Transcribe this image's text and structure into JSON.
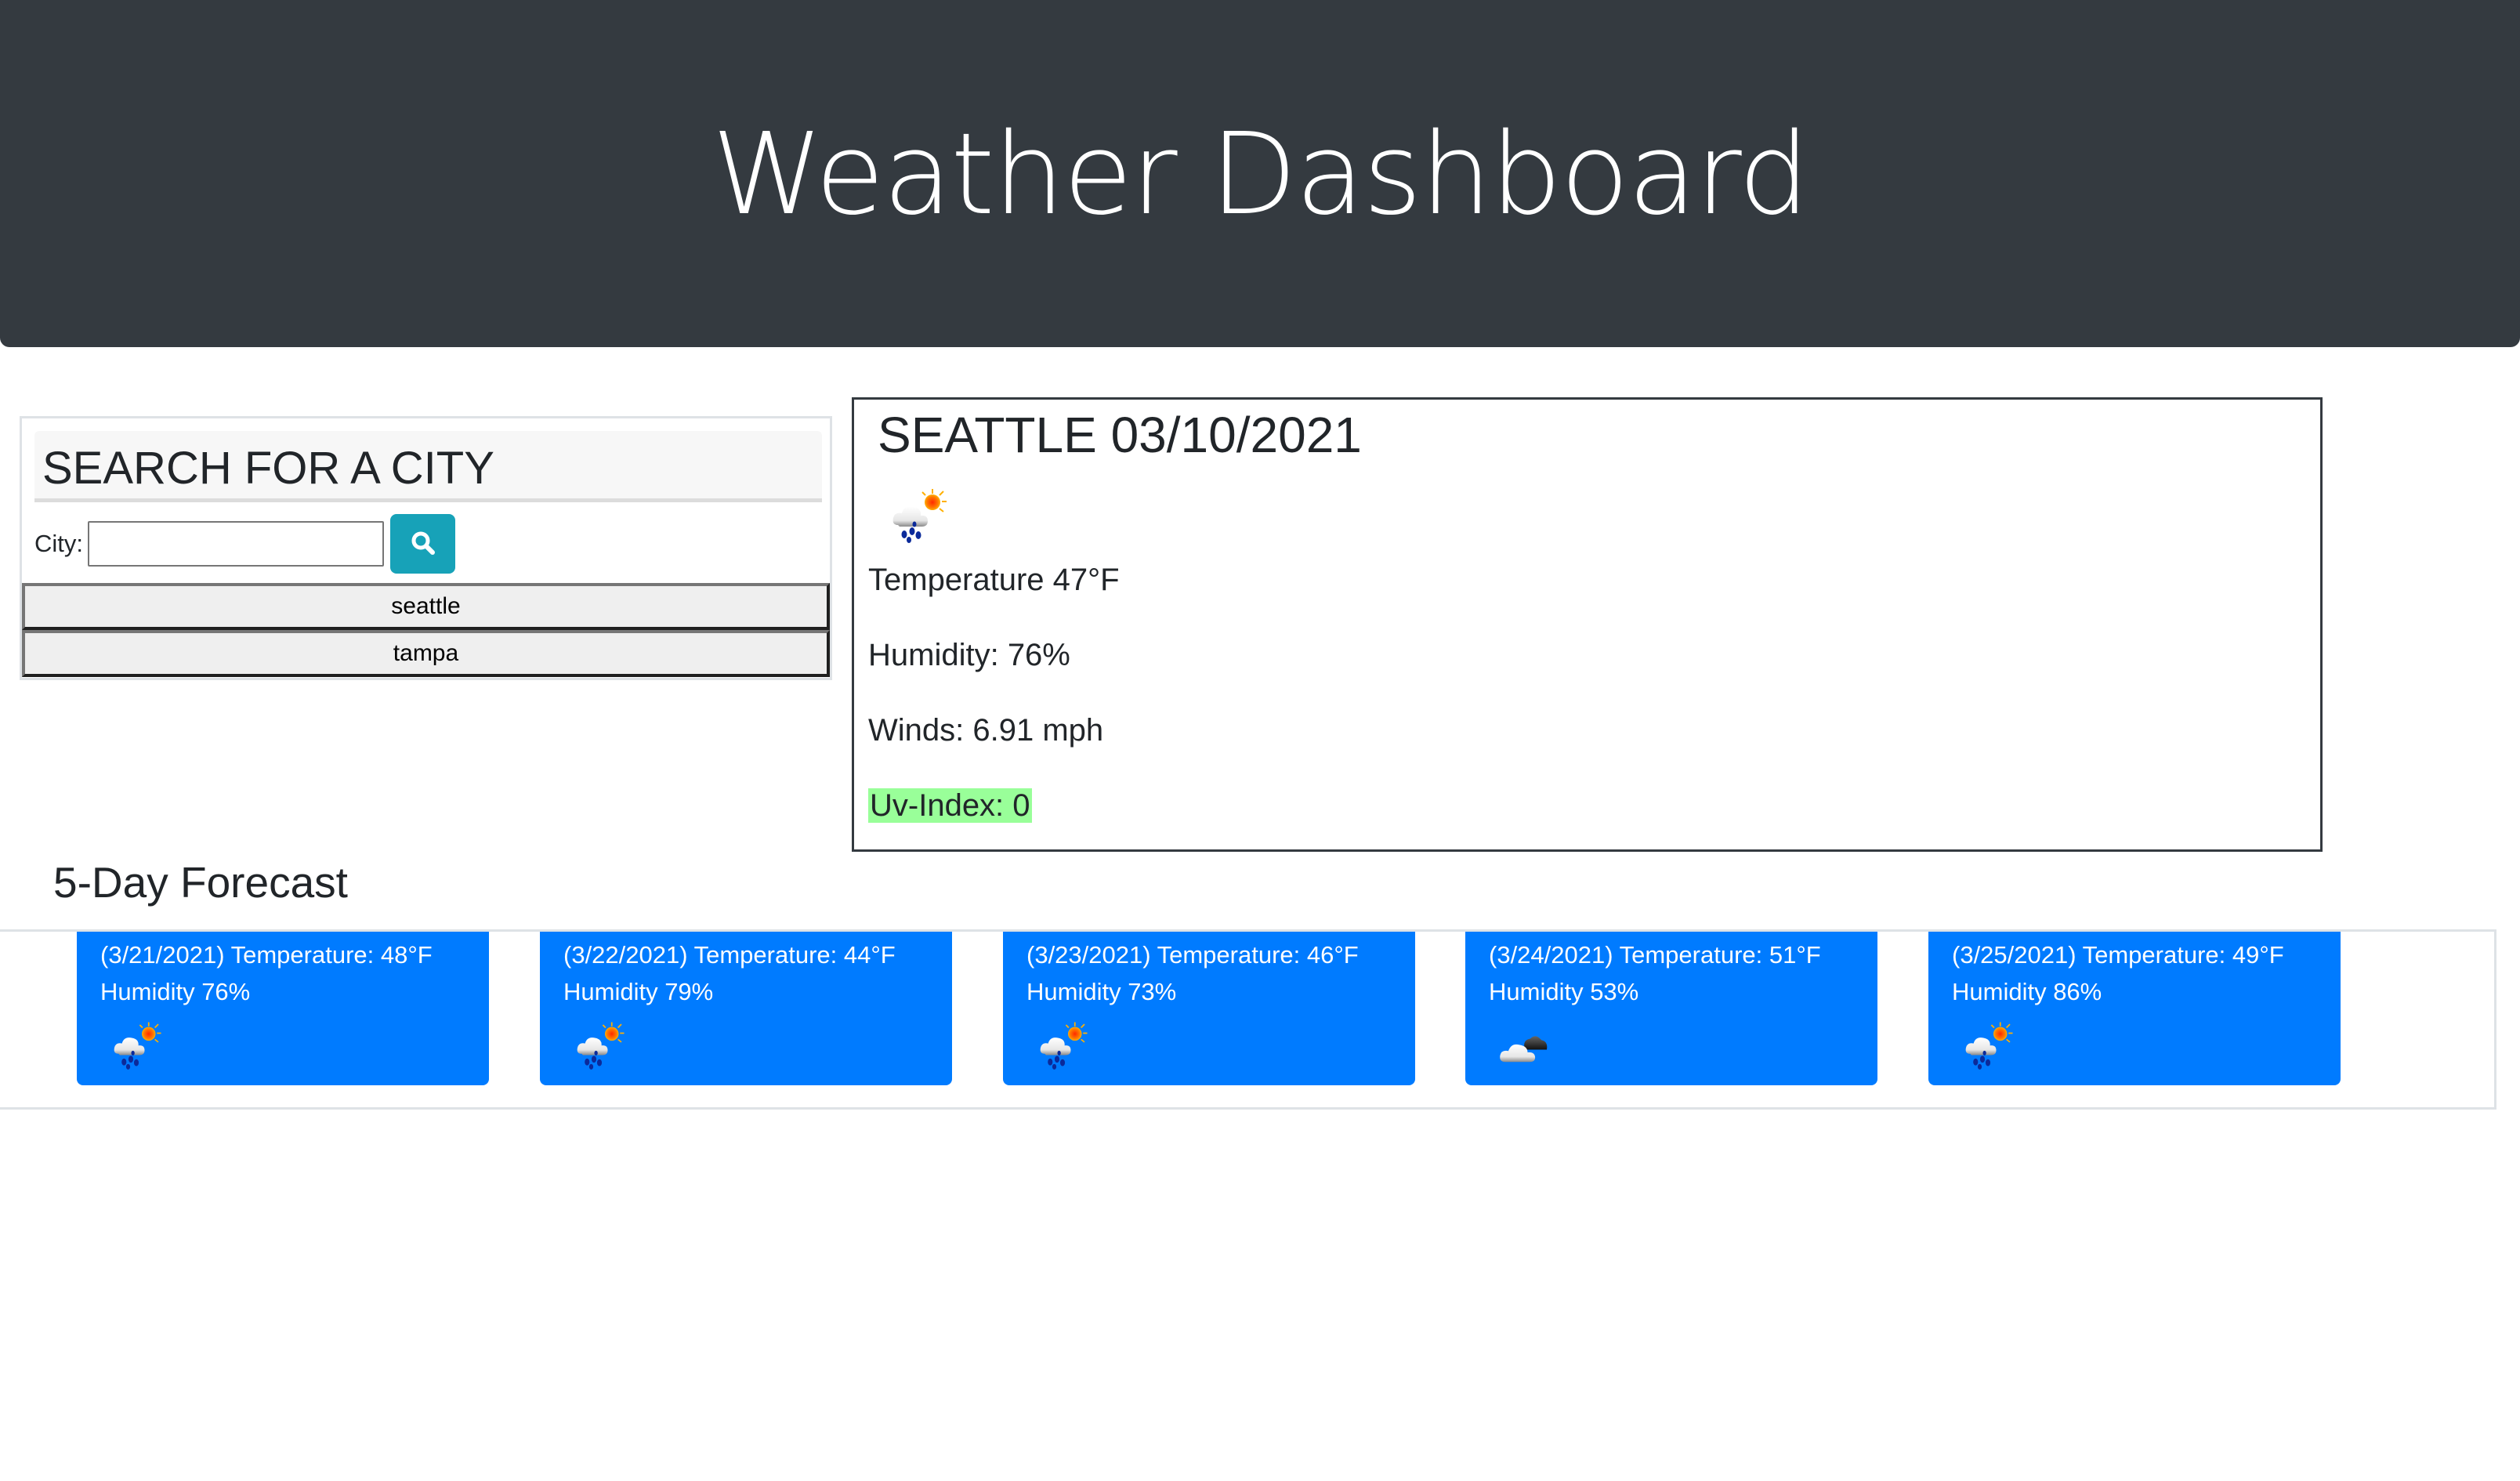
{
  "header": {
    "title": "Weather Dashboard"
  },
  "search": {
    "heading": "SEARCH FOR A CITY",
    "city_label": "City:",
    "city_value": "",
    "city_placeholder": "",
    "search_icon": "search-icon",
    "button_color": "#17a2b8",
    "history": [
      {
        "label": "seattle"
      },
      {
        "label": "tampa"
      }
    ]
  },
  "current": {
    "title": "SEATTLE 03/10/2021",
    "icon": "rain-sun-icon",
    "temperature": "Temperature 47°F",
    "humidity": "Humidity: 76%",
    "winds": "Winds: 6.91 mph",
    "uv_index": "Uv-Index: 0",
    "uv_color": "#99ff99"
  },
  "forecast": {
    "title": "5-Day Forecast",
    "card_color": "#007bff",
    "days": [
      {
        "line1": "(3/21/2021) Temperature: 48°F",
        "line2": "Humidity 76%",
        "icon": "rain-sun-icon"
      },
      {
        "line1": "(3/22/2021) Temperature: 44°F",
        "line2": "Humidity 79%",
        "icon": "rain-sun-icon"
      },
      {
        "line1": "(3/23/2021) Temperature: 46°F",
        "line2": "Humidity 73%",
        "icon": "rain-sun-icon"
      },
      {
        "line1": "(3/24/2021) Temperature: 51°F",
        "line2": "Humidity 53%",
        "icon": "broken-clouds-icon"
      },
      {
        "line1": "(3/25/2021) Temperature: 49°F",
        "line2": "Humidity 86%",
        "icon": "rain-sun-icon"
      }
    ]
  }
}
